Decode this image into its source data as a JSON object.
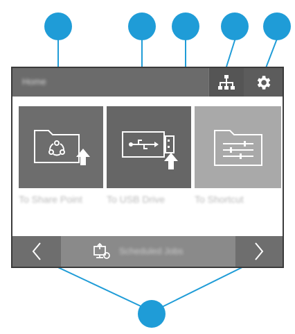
{
  "header": {
    "title": "Home"
  },
  "tiles": [
    {
      "label": "To Share Point",
      "icon": "sharepoint-folder-upload-icon"
    },
    {
      "label": "To USB Drive",
      "icon": "usb-drive-upload-icon"
    },
    {
      "label": "To Shortcut",
      "icon": "shortcut-folder-sliders-icon"
    }
  ],
  "footer": {
    "action_label": "Scheduled Jobs",
    "action_icon": "scheduled-jobs-icon",
    "prev_icon": "chevron-left-icon",
    "next_icon": "chevron-right-icon"
  },
  "toolbar": {
    "network_icon": "network-icon",
    "settings_icon": "gear-icon"
  },
  "colors": {
    "callout": "#1f9cd7",
    "bar": "#6b6b6b",
    "tile_dark": "#6d6d6d",
    "tile_light": "#a9a9a9"
  }
}
